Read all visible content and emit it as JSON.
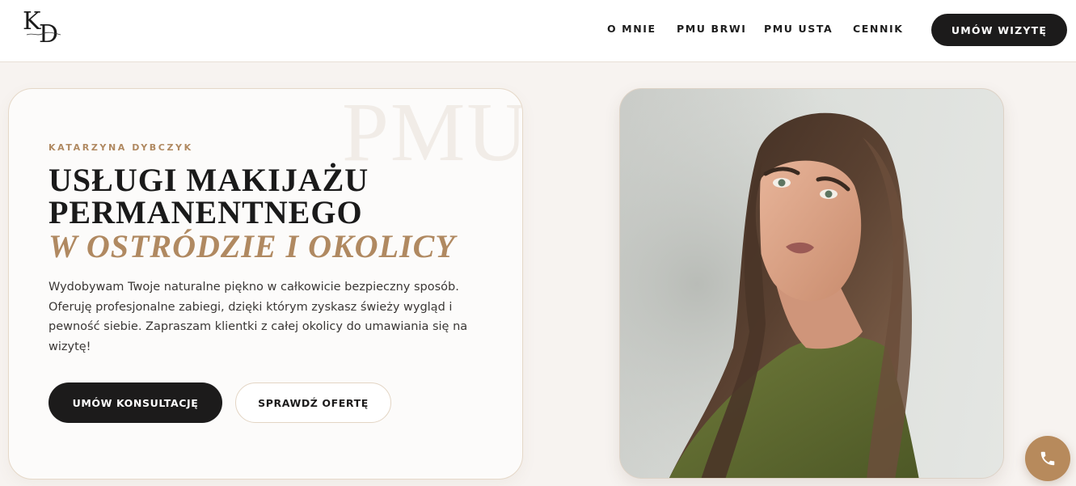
{
  "header": {
    "logo_alt": "KD",
    "nav": [
      {
        "label": "O MNIE"
      },
      {
        "label": "PMU BRWI"
      },
      {
        "label": "PMU USTA"
      },
      {
        "label": "CENNIK"
      }
    ],
    "cta_label": "UMÓW WIZYTĘ"
  },
  "hero": {
    "watermark": "PMU",
    "eyebrow": "KATARZYNA DYBCZYK",
    "title_line1": "USŁUGI MAKIJAŻU",
    "title_line2": "PERMANENTNEGO",
    "title_italic": "W OSTRÓDZIE I OKOLICY",
    "description": "Wydobywam Twoje naturalne piękno w całkowicie bezpieczny sposób. Oferuję profesjonalne zabiegi, dzięki którym zyskasz świeży wygląd i pewność siebie. Zapraszam klientki z całej okolicy do umawiania się na wizytę!",
    "primary_button": "UMÓW KONSULTACJĘ",
    "secondary_button": "SPRAWDŹ OFERTĘ"
  },
  "colors": {
    "accent": "#b08961",
    "dark": "#1c1b1b",
    "background": "#f7f3f0"
  },
  "icons": {
    "fab": "phone-icon"
  }
}
